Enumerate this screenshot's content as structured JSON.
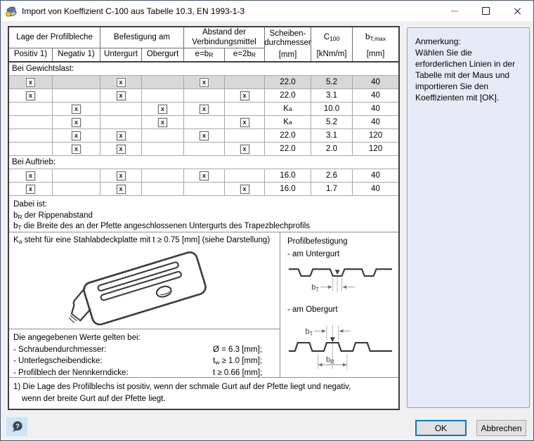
{
  "window": {
    "title": "Import von Koeffizient C-100 aus Tabelle 10.3, EN 1993-1-3",
    "app_icon": "module-cylinder-icon",
    "minimize_icon": "minimize-icon",
    "maximize_icon": "maximize-icon",
    "close_icon": "close-icon"
  },
  "table": {
    "check_glyph": "x",
    "groups": {
      "lage": "Lage der Profilbleche",
      "befestigung": "Befestigung am",
      "abstand": "Abstand der Verbindungsmittel"
    },
    "sub": {
      "positiv": "Positiv 1)",
      "negativ": "Negativ 1)",
      "untergurt": "Untergurt",
      "obergurt": "Obergurt",
      "e1_base": "e=b",
      "e1_sub": "R",
      "e2_base": "e=2b",
      "e2_sub": "R"
    },
    "cols": {
      "scheiben_line1": "Scheiben-",
      "scheiben_line2": "durchmesser",
      "scheiben_unit": "[mm]",
      "c100_base": "C",
      "c100_sub": "100",
      "c100_unit": "[kNm/m]",
      "bt_base": "b",
      "bt_sub": "T,max",
      "bt_unit": "[mm]"
    },
    "rows": [
      {
        "type": "section",
        "label": "Bei Gewichtslast:"
      },
      {
        "type": "data",
        "selected": true,
        "checks": [
          1,
          0,
          1,
          0,
          1,
          0
        ],
        "diameter": "22.0",
        "c100": "5.2",
        "btmax": "40"
      },
      {
        "type": "data",
        "checks": [
          1,
          0,
          1,
          0,
          0,
          1
        ],
        "diameter": "22.0",
        "c100": "3.1",
        "btmax": "40"
      },
      {
        "type": "data",
        "checks": [
          0,
          1,
          0,
          1,
          1,
          0
        ],
        "diameter": {
          "base": "K",
          "sub": "a"
        },
        "c100": "10.0",
        "btmax": "40"
      },
      {
        "type": "data",
        "checks": [
          0,
          1,
          0,
          1,
          0,
          1
        ],
        "diameter": {
          "base": "K",
          "sub": "a"
        },
        "c100": "5.2",
        "btmax": "40"
      },
      {
        "type": "data",
        "checks": [
          0,
          1,
          1,
          0,
          1,
          0
        ],
        "diameter": "22.0",
        "c100": "3.1",
        "btmax": "120"
      },
      {
        "type": "data",
        "checks": [
          0,
          1,
          1,
          0,
          0,
          1
        ],
        "diameter": "22.0",
        "c100": "2.0",
        "btmax": "120"
      },
      {
        "type": "section",
        "label": "Bei Auftrieb:"
      },
      {
        "type": "data",
        "checks": [
          1,
          0,
          1,
          0,
          1,
          0
        ],
        "diameter": "16.0",
        "c100": "2.6",
        "btmax": "40"
      },
      {
        "type": "data",
        "checks": [
          1,
          0,
          1,
          0,
          0,
          1
        ],
        "diameter": "16.0",
        "c100": "1.7",
        "btmax": "40"
      }
    ]
  },
  "notes": {
    "dabei_intro": "Dabei ist:",
    "br_base": "b",
    "br_sub": "R",
    "br_rest": " der Rippenabstand",
    "bt_base": "b",
    "bt_sub": "T",
    "bt_rest": " die Breite des an der Pfette angeschlossenen Untergurts des Trapezblechprofils",
    "ka_base": "K",
    "ka_sub": "a",
    "ka_rest": " steht für eine Stahlabdeckplatte mit t ≥ 0.75 [mm] (siehe Darstellung)",
    "values_intro": "Die angegebenen Werte gelten bei:",
    "v1_label": "- Schraubendurchmesser:",
    "v1_value": "Ø = 6.3 [mm];",
    "v2_label": "- Unterlegscheibendicke:",
    "v2_base": "t",
    "v2_sub": "w",
    "v2_rest": " ≥ 1.0 [mm];",
    "v3_label": "- Profilblech der Nennkerndicke:",
    "v3_value": "t ≥ 0.66 [mm];",
    "footnote_line1": "1) Die Lage des Profilblechs ist positiv, wenn der schmale Gurt auf der Pfette liegt und negativ,",
    "footnote_line2": "wenn der breite Gurt auf der Pfette liegt."
  },
  "profiles": {
    "title": "Profilbefestigung",
    "untergurt": "- am Untergurt",
    "obergurt": "- am Obergurt",
    "bt_base": "b",
    "bt_sub": "T",
    "br_base": "b",
    "br_sub": "R"
  },
  "sidebar": {
    "title": "Anmerkung:",
    "text": "Wählen Sie die erforderlichen Linien in der Tabelle mit der Maus und importieren Sie den Koeffizienten mit [OK]."
  },
  "footer": {
    "ok": "OK",
    "cancel": "Abbrechen",
    "help_icon": "help-balloon-icon",
    "help_glyph": "?"
  },
  "colors": {
    "accent": "#0078d7",
    "sidebar_bg": "#e7ebf7",
    "sidebar_border": "#95a2c6",
    "selected_row": "#d8d8d8"
  }
}
